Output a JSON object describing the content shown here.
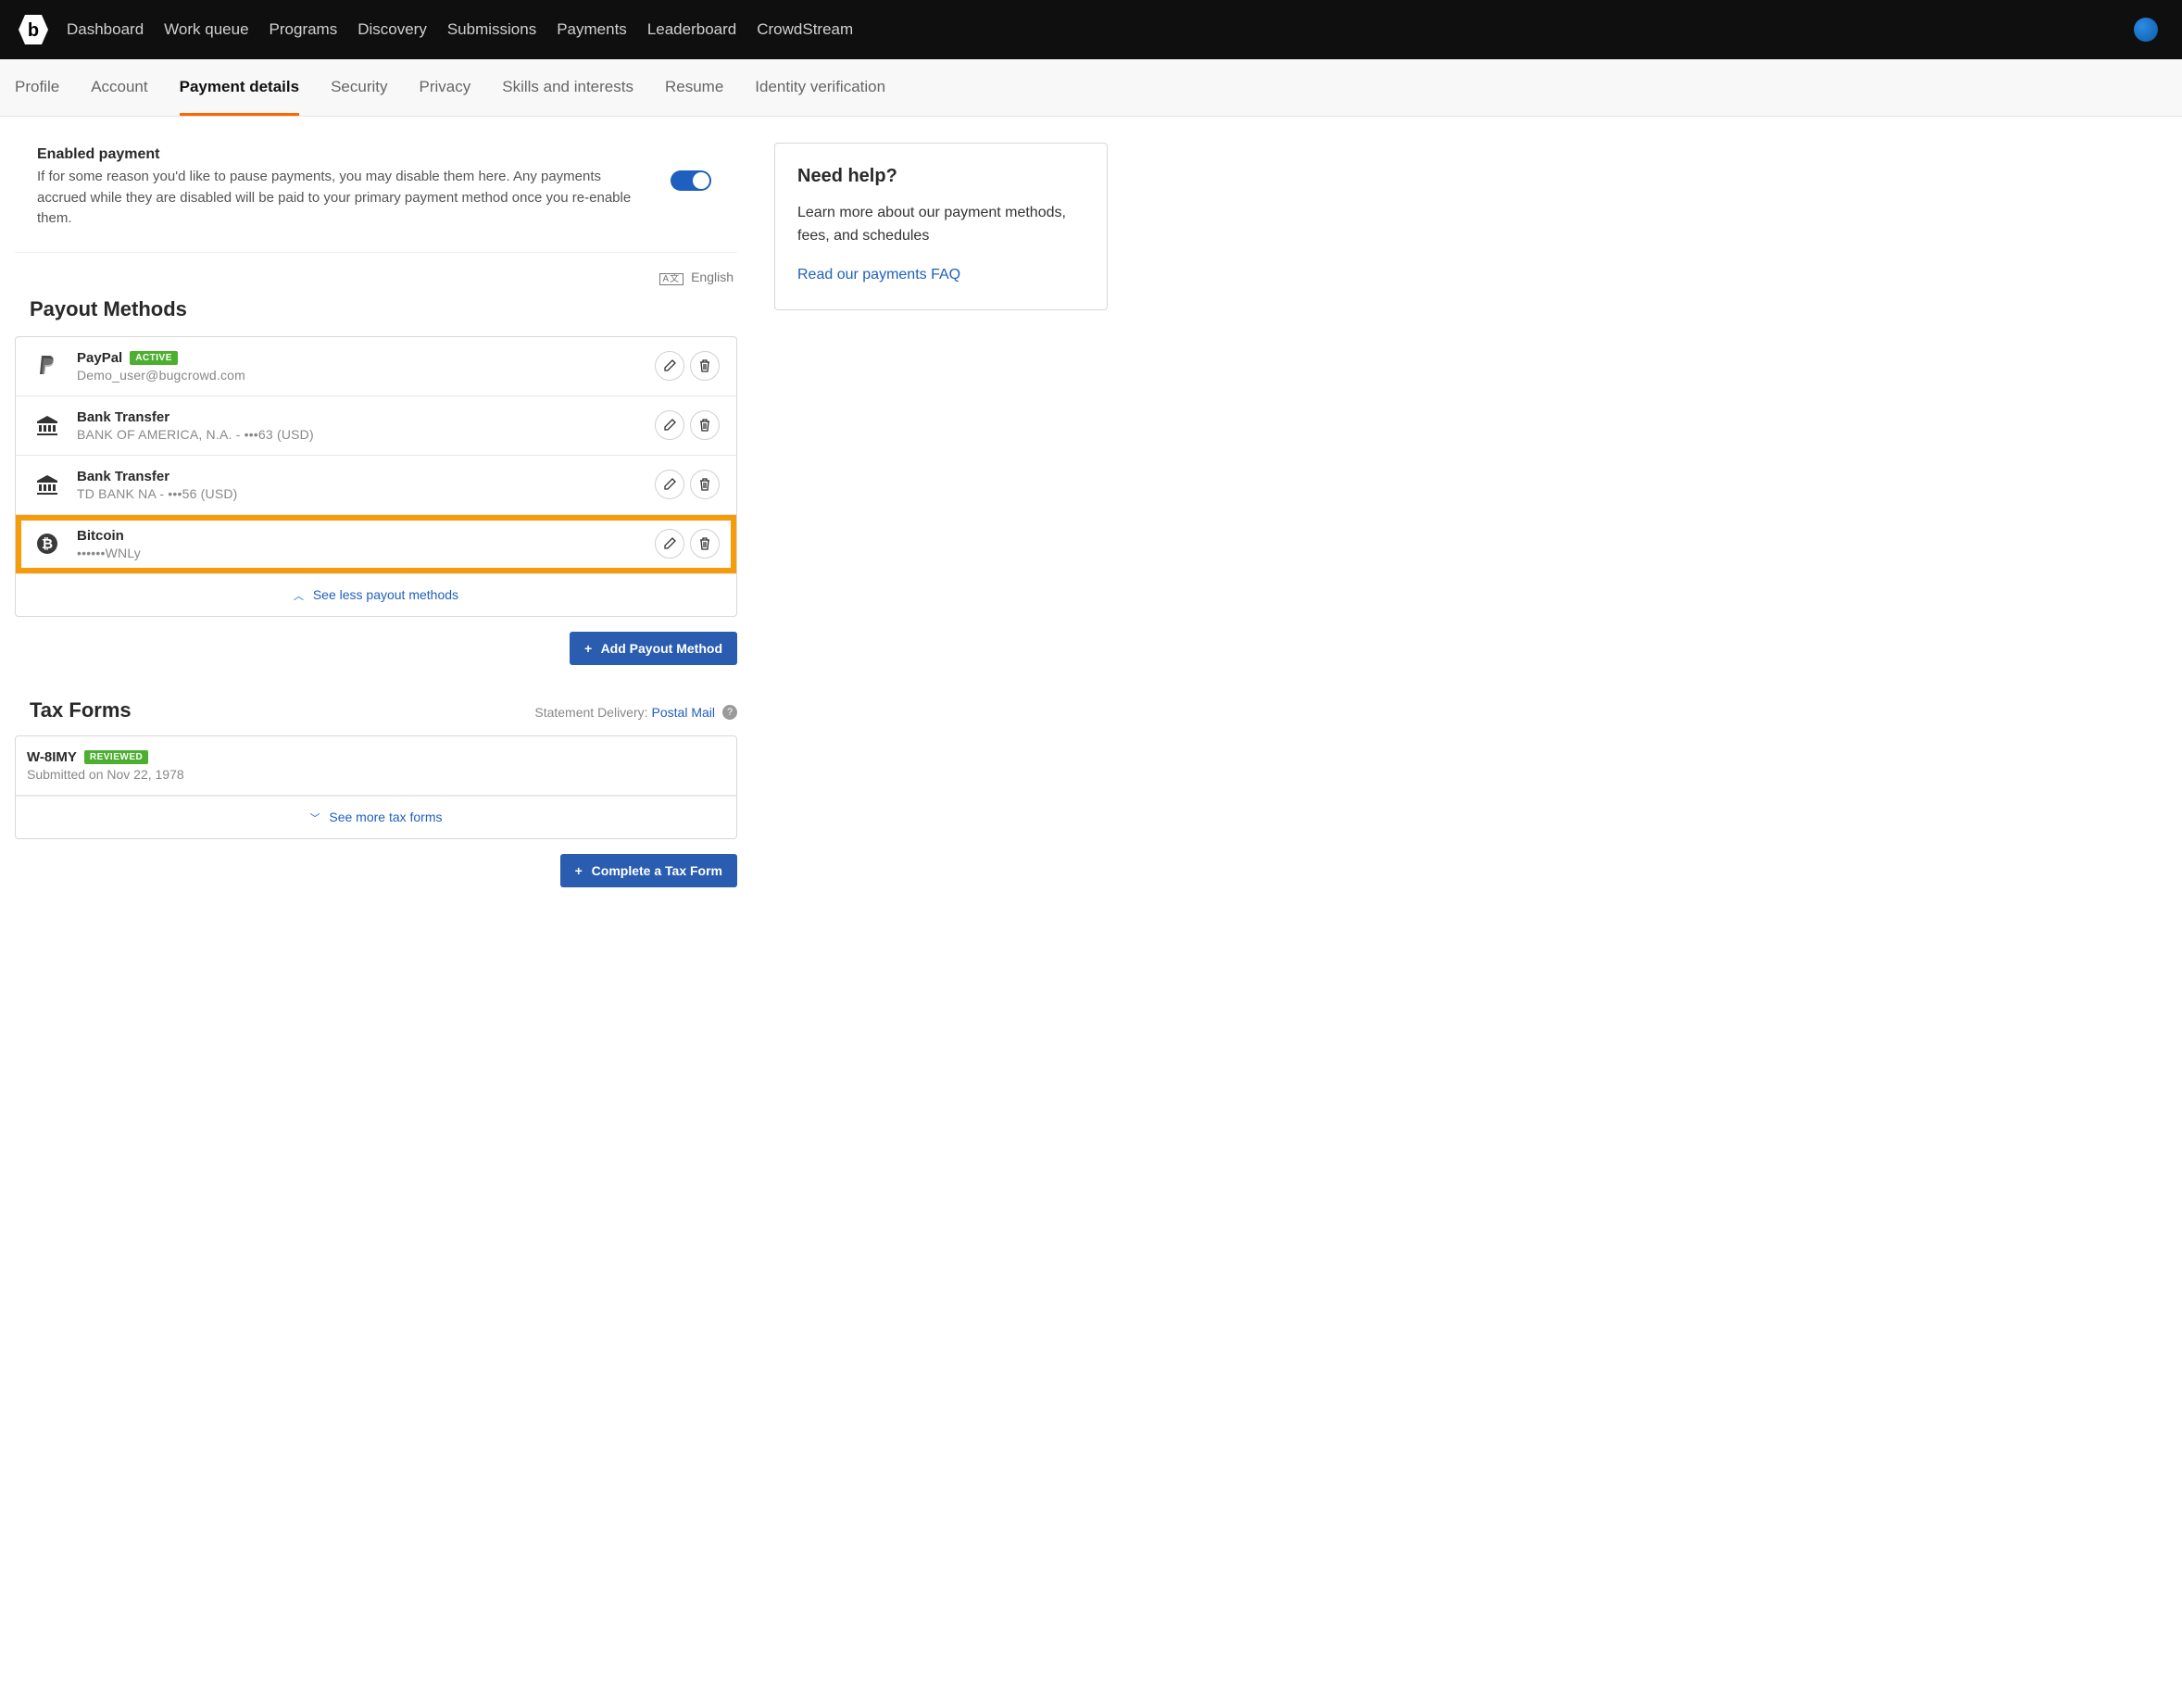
{
  "topnav": {
    "items": [
      "Dashboard",
      "Work queue",
      "Programs",
      "Discovery",
      "Submissions",
      "Payments",
      "Leaderboard",
      "CrowdStream"
    ]
  },
  "subnav": {
    "items": [
      "Profile",
      "Account",
      "Payment details",
      "Security",
      "Privacy",
      "Skills and interests",
      "Resume",
      "Identity verification"
    ],
    "active": "Payment details"
  },
  "enabled": {
    "title": "Enabled payment",
    "desc": "If for some reason you'd like to pause payments, you may disable them here. Any payments accrued while they are disabled will be paid to your primary payment method once you re-enable them."
  },
  "language": {
    "label": "English"
  },
  "payout": {
    "heading": "Payout Methods",
    "methods": [
      {
        "title": "PayPal",
        "sub": "Demo_user@bugcrowd.com",
        "badge": "ACTIVE"
      },
      {
        "title": "Bank Transfer",
        "sub": "BANK OF AMERICA, N.A. - •••63 (USD)"
      },
      {
        "title": "Bank Transfer",
        "sub": "TD BANK NA - •••56 (USD)"
      },
      {
        "title": "Bitcoin",
        "sub": "••••••WNLy"
      }
    ],
    "collapse": "See less payout methods",
    "add_btn": "Add Payout Method"
  },
  "tax": {
    "heading": "Tax Forms",
    "statement_label": "Statement Delivery:",
    "statement_value": "Postal Mail",
    "forms": [
      {
        "title": "W-8IMY",
        "badge": "REVIEWED",
        "sub": "Submitted on Nov 22, 1978"
      }
    ],
    "expand": "See more tax forms",
    "complete_btn": "Complete a Tax Form"
  },
  "help": {
    "heading": "Need help?",
    "body": "Learn more about our payment methods, fees, and schedules",
    "link": "Read our payments FAQ"
  }
}
